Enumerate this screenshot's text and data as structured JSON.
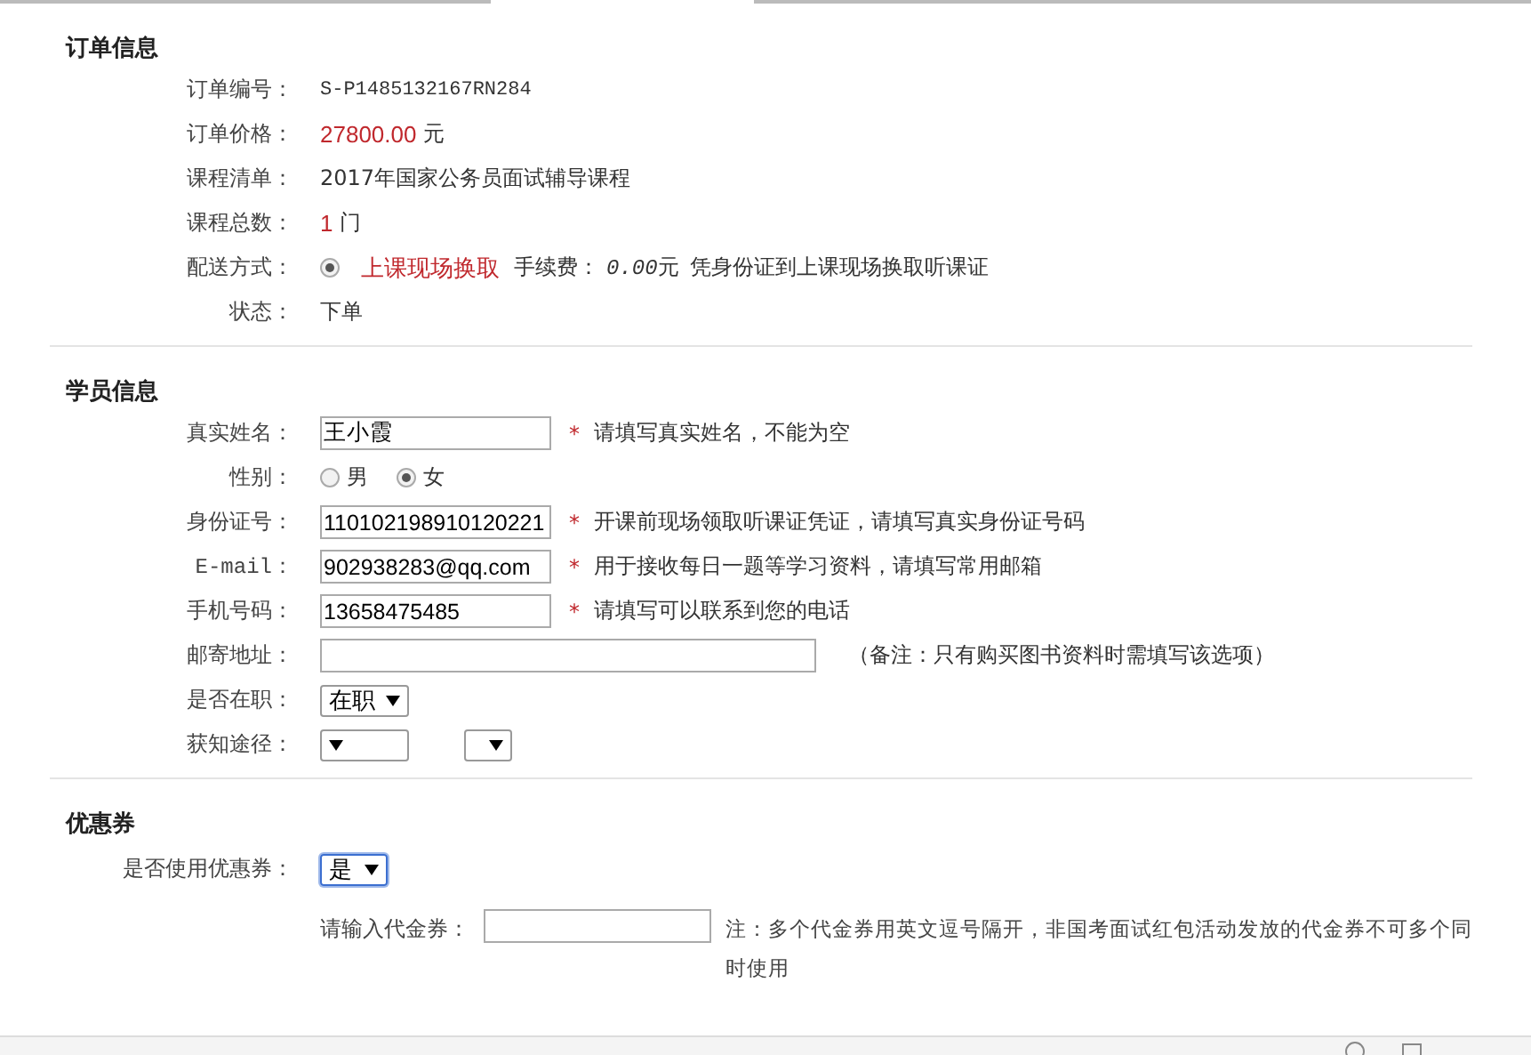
{
  "order_info": {
    "title": "订单信息",
    "rows": [
      {
        "kind": "code",
        "label": "订单编号：",
        "value": "S-P1485132167RN284"
      },
      {
        "kind": "amount",
        "label": "订单价格：",
        "amount": "27800.00",
        "unit": "元"
      },
      {
        "kind": "plain",
        "label": "课程清单：",
        "value": "2017年国家公务员面试辅导课程"
      },
      {
        "kind": "amount",
        "label": "课程总数：",
        "amount": "1",
        "unit": "门"
      },
      {
        "kind": "delivery",
        "label": "配送方式：",
        "option": {
          "label": "上课现场换取",
          "selected": true
        },
        "fee_label": "手续费：",
        "fee": "0.00",
        "fee_unit": "元",
        "note": "凭身份证到上课现场换取听课证"
      },
      {
        "kind": "plain",
        "label": "状态：",
        "value": "下单"
      }
    ]
  },
  "student_info": {
    "title": "学员信息",
    "rows": [
      {
        "kind": "input",
        "label": "真实姓名：",
        "value": "王小霞",
        "required_mark": "*",
        "hint": "请填写真实姓名，不能为空"
      },
      {
        "kind": "radio",
        "label": "性别：",
        "options": [
          {
            "label": "男",
            "selected": false
          },
          {
            "label": "女",
            "selected": true
          }
        ]
      },
      {
        "kind": "input",
        "label": "身份证号：",
        "value": "110102198910120221",
        "required_mark": "*",
        "hint": "开课前现场领取听课证凭证，请填写真实身份证号码"
      },
      {
        "kind": "input",
        "label": "E-mail：",
        "value": "902938283@qq.com",
        "required_mark": "*",
        "hint": "用于接收每日一题等学习资料，请填写常用邮箱"
      },
      {
        "kind": "input",
        "label": "手机号码：",
        "value": "13658475485",
        "required_mark": "*",
        "hint": "请填写可以联系到您的电话"
      },
      {
        "kind": "input",
        "label": "邮寄地址：",
        "hint": "（备注：只有购买图书资料时需填写该选项）"
      },
      {
        "kind": "select",
        "label": "是否在职：",
        "selects": [
          {
            "kind": "dropdown",
            "value": "在职"
          }
        ]
      },
      {
        "kind": "select",
        "label": "获知途径：",
        "selects": [
          {
            "kind": "dropdown"
          },
          {
            "kind": "dropdown"
          }
        ]
      }
    ]
  },
  "coupon": {
    "title": "优惠券",
    "use_label": "是否使用优惠券：",
    "use_select": {
      "value": "是",
      "focused": true
    },
    "code_label": "请输入代金券：",
    "note": "注：多个代金券用英文逗号隔开，非国考面试红包活动发放的代金券不可多个同时使用"
  }
}
